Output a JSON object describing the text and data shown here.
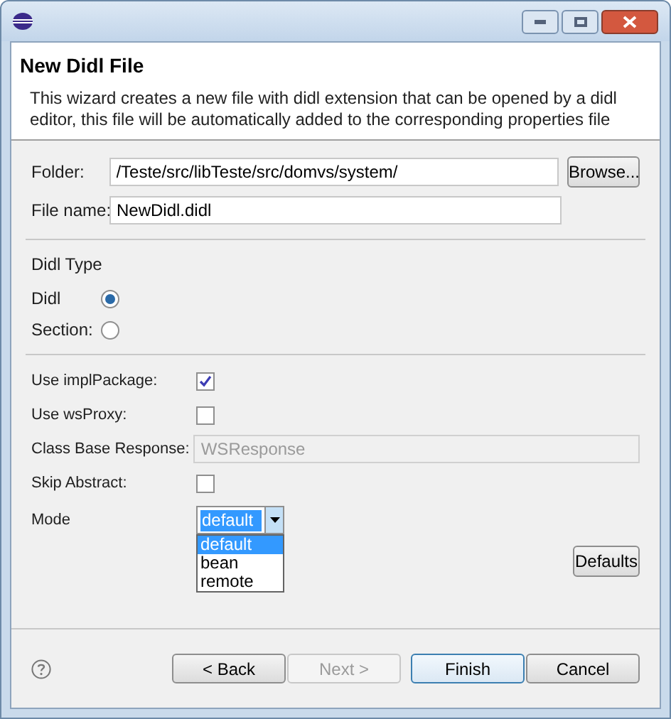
{
  "header": {
    "title": "New Didl File",
    "description": "This wizard creates a new file with didl extension that can be opened by a didl editor, this file will be automatically added to the corresponding properties file"
  },
  "folder": {
    "label": "Folder:",
    "value": "/Teste/src/libTeste/src/domvs/system/",
    "button": "Browse..."
  },
  "file_name": {
    "label": "File name:",
    "value": "NewDidl.didl"
  },
  "didl_type": {
    "label": "Didl Type",
    "options": [
      {
        "label": "Didl",
        "selected": true
      },
      {
        "label": "Section:",
        "selected": false
      }
    ]
  },
  "settings": [
    {
      "kind": "checkbox",
      "label": "Use implPackage:",
      "checked": true
    },
    {
      "kind": "checkbox",
      "label": "Use wsProxy:",
      "checked": false
    },
    {
      "kind": "text",
      "label": "Class Base Response:",
      "value": "WSResponse",
      "disabled": true
    },
    {
      "kind": "checkbox",
      "label": "Skip Abstract:",
      "checked": false
    }
  ],
  "mode": {
    "label": "Mode",
    "value": "default",
    "expanded": true,
    "options": [
      {
        "label": "default",
        "selected": true
      },
      {
        "label": "bean",
        "selected": false
      },
      {
        "label": "remote",
        "selected": false
      }
    ]
  },
  "defaults_button": "Defaults",
  "buttons": [
    {
      "label": "< Back",
      "disabled": false,
      "default": false
    },
    {
      "label": "Next >",
      "disabled": true,
      "default": false
    },
    {
      "label": "Finish",
      "disabled": false,
      "default": true
    },
    {
      "label": "Cancel",
      "disabled": false,
      "default": false
    }
  ]
}
